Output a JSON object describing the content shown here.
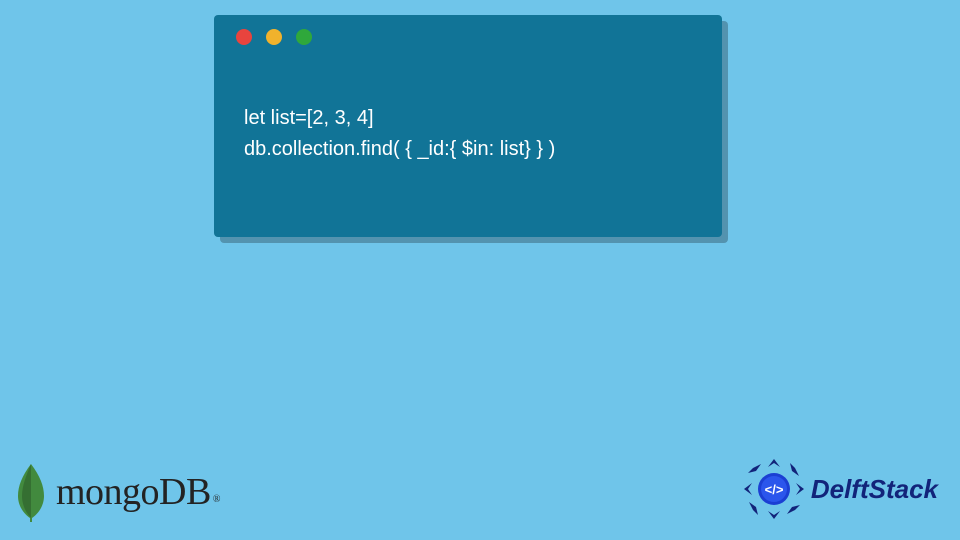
{
  "code_window": {
    "lines": [
      "let list=[2, 3, 4]",
      "db.collection.find( { _id:{ $in: list} } )"
    ],
    "dots": [
      "red",
      "yellow",
      "green"
    ]
  },
  "logos": {
    "mongo": {
      "text": "mongoDB",
      "trademark": "®"
    },
    "delft": {
      "text": "DelftStack"
    }
  },
  "colors": {
    "background": "#6fc5ea",
    "code_bg": "#117497",
    "code_text": "#ffffff",
    "delft_blue": "#12247a",
    "mongo_green": "#428a3e"
  }
}
